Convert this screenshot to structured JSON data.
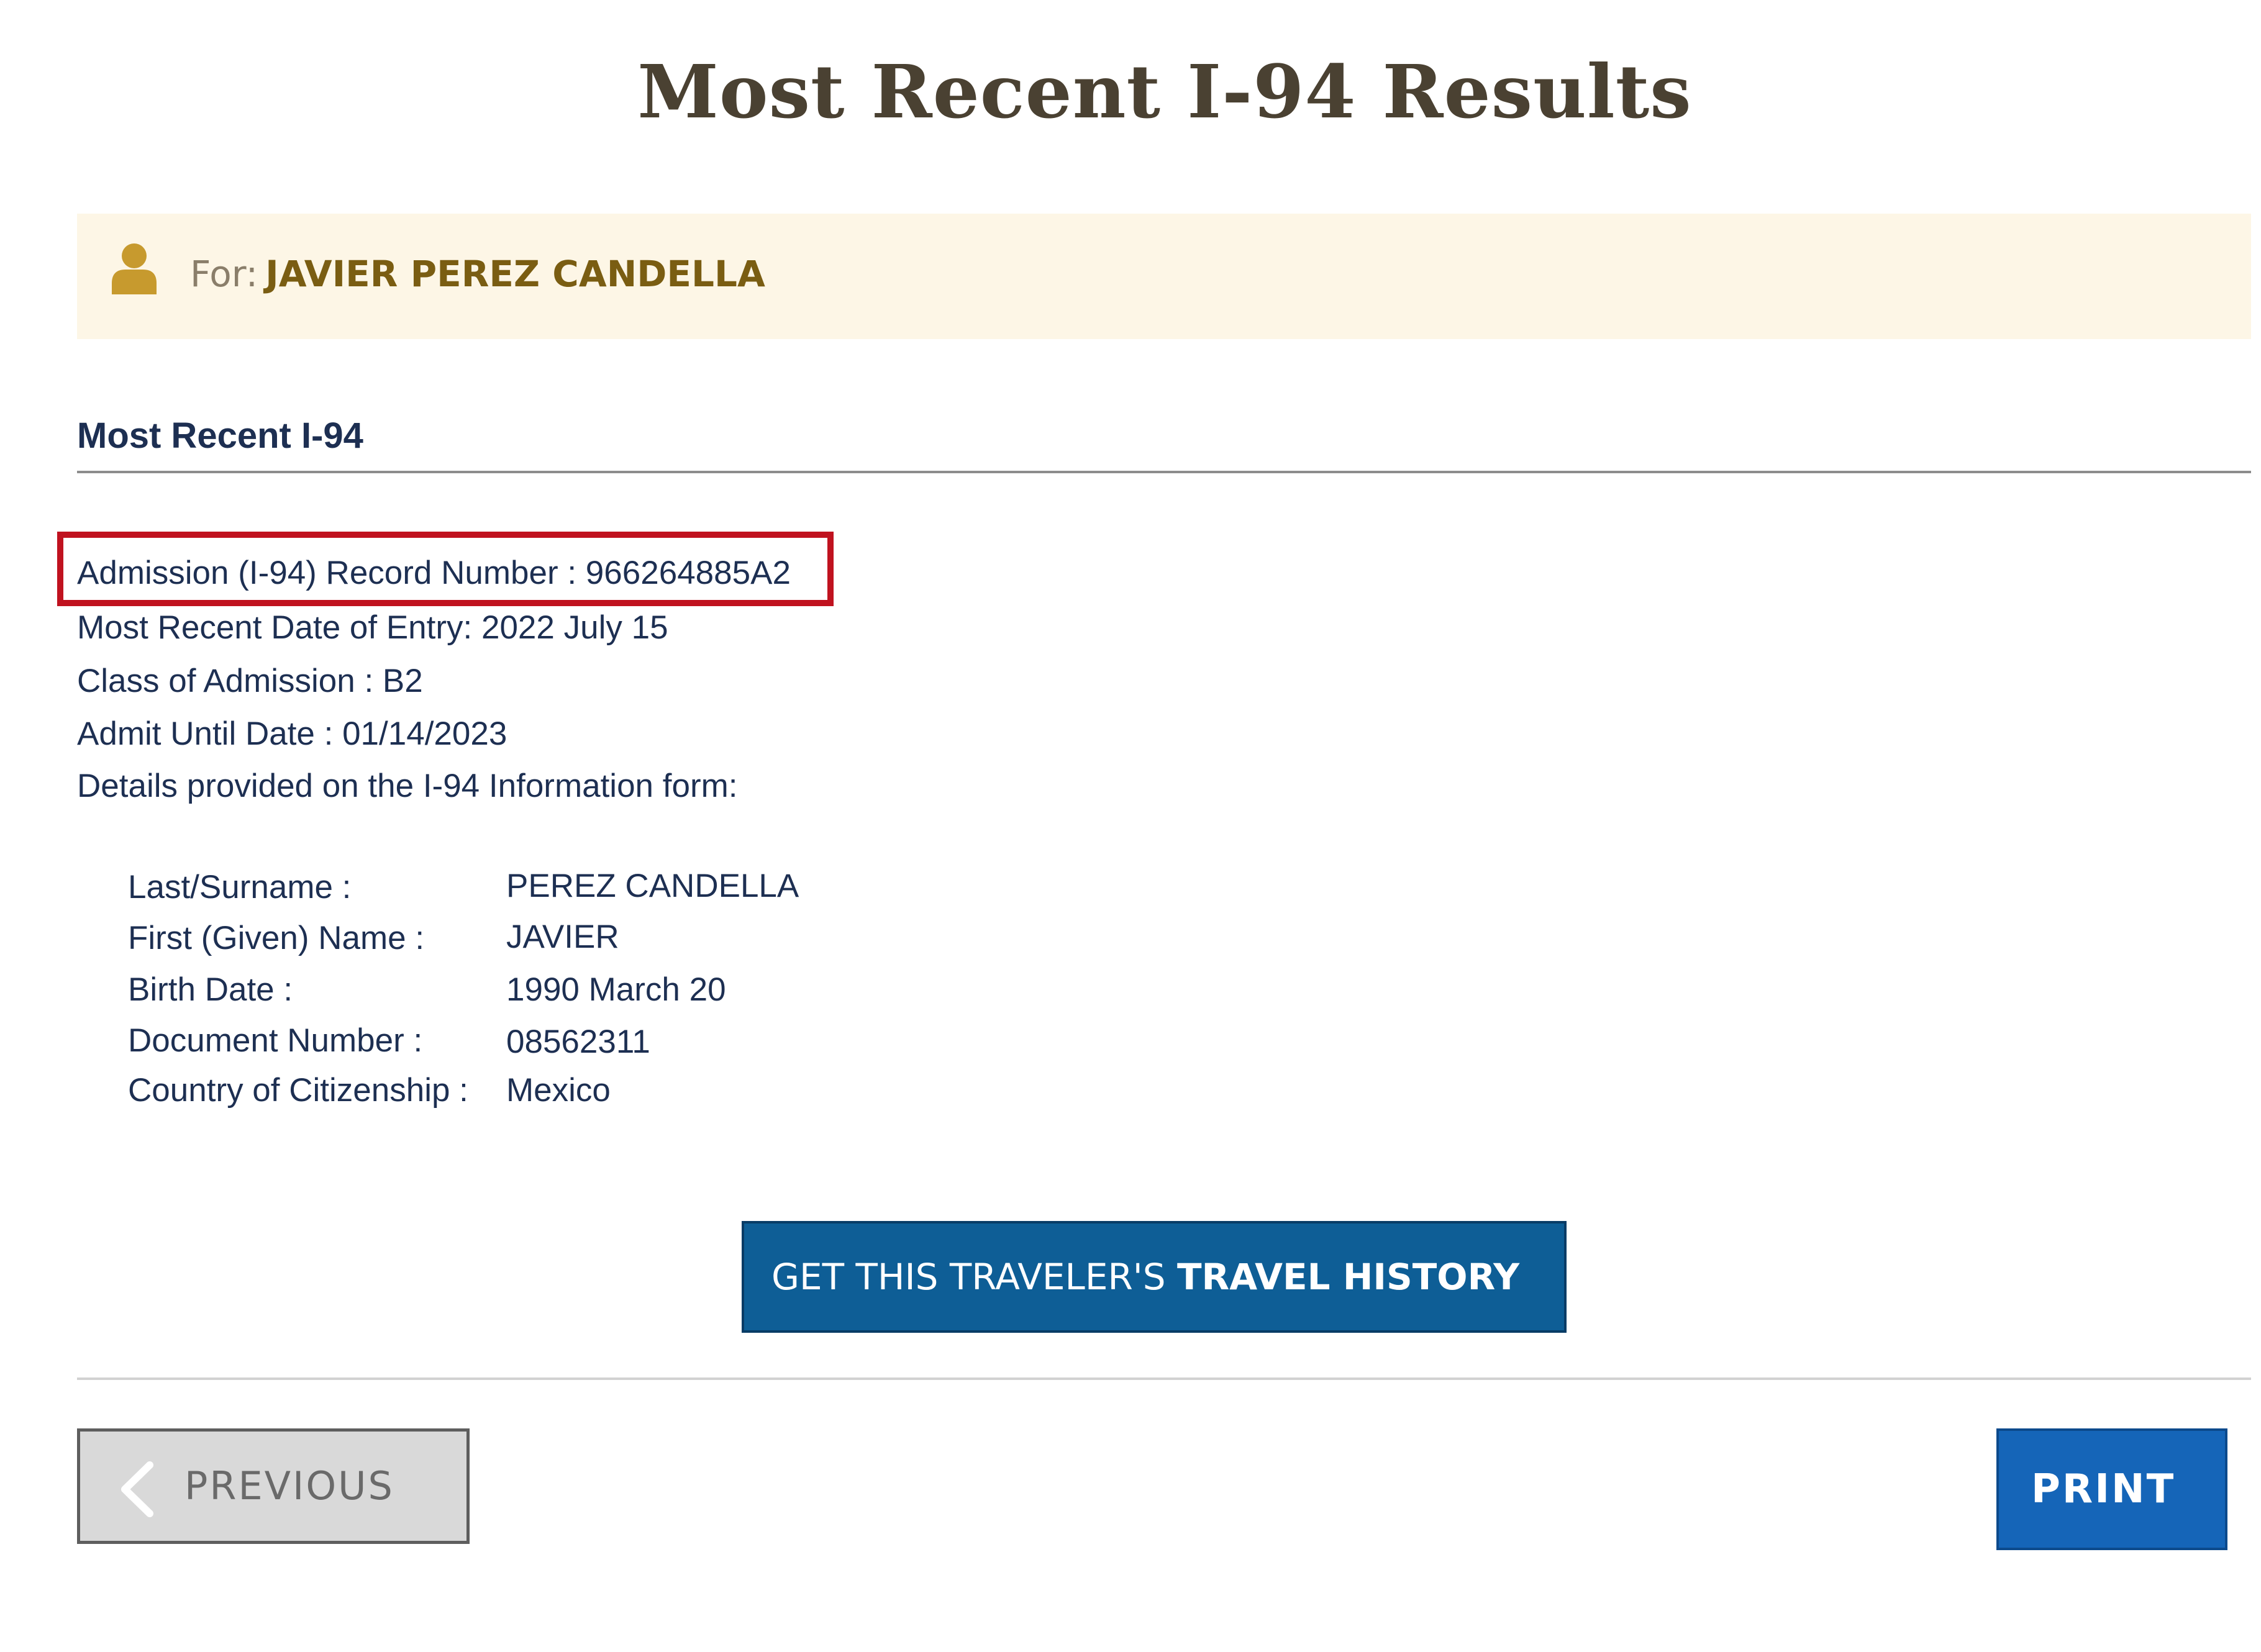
{
  "page": {
    "title": "Most Recent I-94 Results"
  },
  "traveler_banner": {
    "icon": "person-icon",
    "for_label": "For:",
    "name": "JAVIER PEREZ CANDELLA"
  },
  "section": {
    "heading": "Most Recent I-94"
  },
  "record": {
    "record_number_line": "Admission (I-94) Record Number : 966264885A2",
    "entry_date_line": "Most Recent Date of Entry: 2022 July 15",
    "class_line": "Class of Admission : B2",
    "admit_until_line": "Admit Until Date : 01/14/2023",
    "details_intro": "Details provided on the I-94 Information form:"
  },
  "details": [
    {
      "label": "Last/Surname :",
      "value": "PEREZ CANDELLA"
    },
    {
      "label": "First (Given) Name :",
      "value": "JAVIER"
    },
    {
      "label": "Birth Date :",
      "value": "1990 March 20"
    },
    {
      "label": "Document Number :",
      "value": "08562311"
    },
    {
      "label": "Country of Citizenship :",
      "value": "Mexico"
    }
  ],
  "actions": {
    "history_prefix": "GET THIS TRAVELER'S",
    "history_bold": "TRAVEL HISTORY",
    "previous_label": "PREVIOUS",
    "print_label": "PRINT"
  },
  "colors": {
    "title": "#4a4132",
    "banner_bg": "#fdf6e6",
    "banner_name": "#7a5d12",
    "icon": "#c79a2e",
    "text_navy": "#1d2f52",
    "highlight": "#c0121f",
    "history_button": "#0e5e96",
    "print_button": "#1565b8",
    "previous_button": "#d9d9d9"
  }
}
